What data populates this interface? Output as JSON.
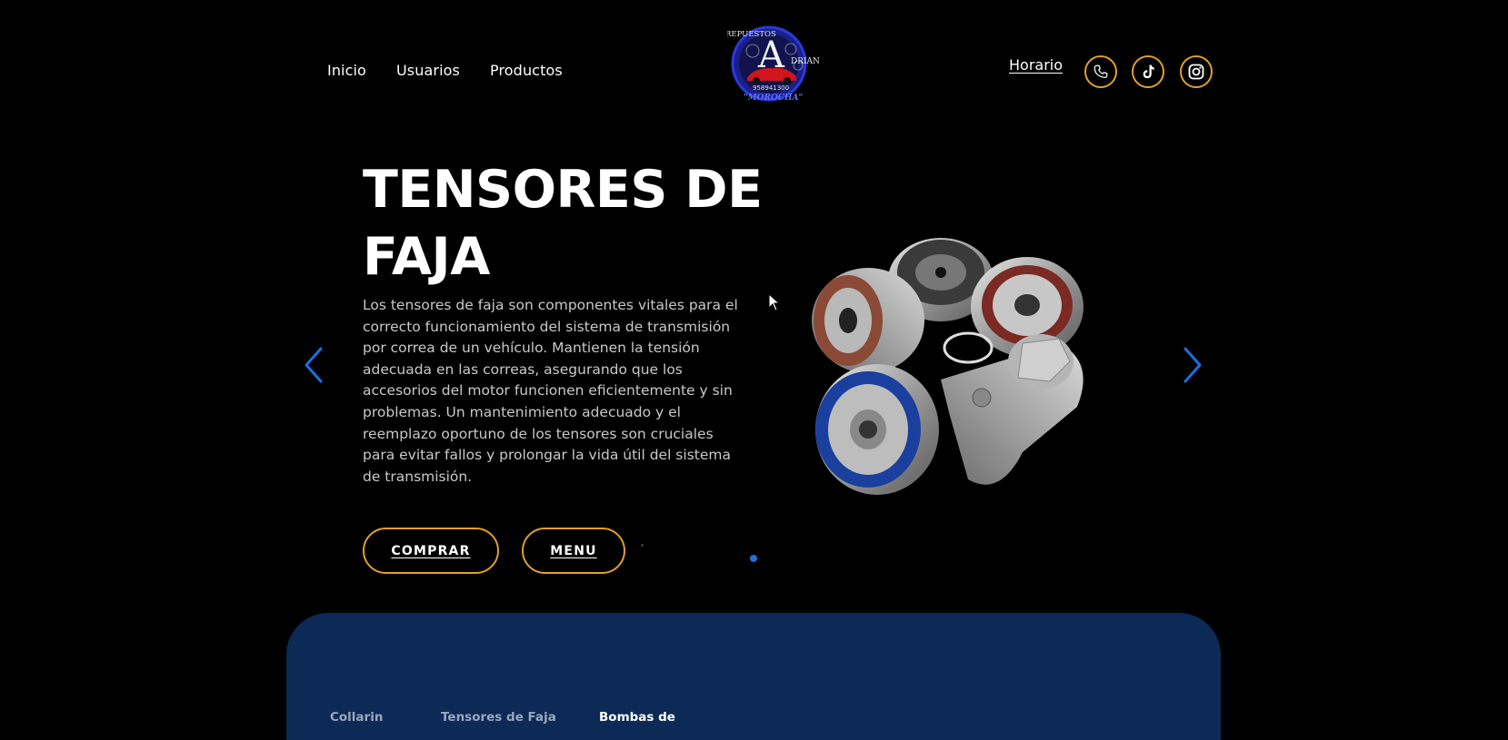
{
  "nav": {
    "links": [
      {
        "label": "Inicio"
      },
      {
        "label": "Usuarios"
      },
      {
        "label": "Productos"
      }
    ],
    "logo": {
      "top_text": "REPUESTOS",
      "letter": "A",
      "side_text": "DRIAN",
      "phone": "958941300",
      "bottom_text": "\"MOROCHA\""
    },
    "horario": "Horario",
    "social_icons": [
      "phone-icon",
      "tiktok-icon",
      "instagram-icon"
    ]
  },
  "hero": {
    "title_line1": "TENSORES DE",
    "title_line2": "FAJA",
    "description": "Los tensores de faja son componentes vitales para el correcto funcionamiento del sistema de transmisión por correa de un vehículo. Mantienen la tensión adecuada en las correas, asegurando que los accesorios del motor funcionen eficientemente y sin problemas. Un mantenimiento adecuado y el reemplazo oportuno de los tensores son cruciales para evitar fallos y prolongar la vida útil del sistema de transmisión.",
    "buy_label": "COMPRAR",
    "menu_label": "MENU"
  },
  "categories": [
    {
      "label": "Collarin"
    },
    {
      "label": "Tensores de Faja"
    },
    {
      "label": "Bombas de"
    }
  ],
  "colors": {
    "accent_border": "#e0a02a",
    "arrow_blue": "#1e6fe0",
    "panel_blue": "#0c2a55"
  }
}
